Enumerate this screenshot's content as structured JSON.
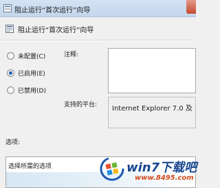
{
  "window": {
    "title": "阻止运行“首次运行”向导",
    "heading": "阻止运行“首次运行”向导"
  },
  "state_options": [
    {
      "label": "未配置(C)",
      "checked": false
    },
    {
      "label": "已启用(E)",
      "checked": true
    },
    {
      "label": "已禁用(D)",
      "checked": false
    }
  ],
  "fields": {
    "note_label": "注释:",
    "note_value": "",
    "platform_label": "支持的平台:",
    "platform_value": "Internet Explorer 7.0 及"
  },
  "options": {
    "label": "选项:",
    "prompt": "选择所需的选项"
  },
  "watermark": {
    "title": "win7下载吧",
    "url": "www.8495.com"
  },
  "colors": {
    "radio_selected": "#1f5fb5",
    "watermark_title": "#17478f",
    "watermark_url": "#d44a1b"
  }
}
